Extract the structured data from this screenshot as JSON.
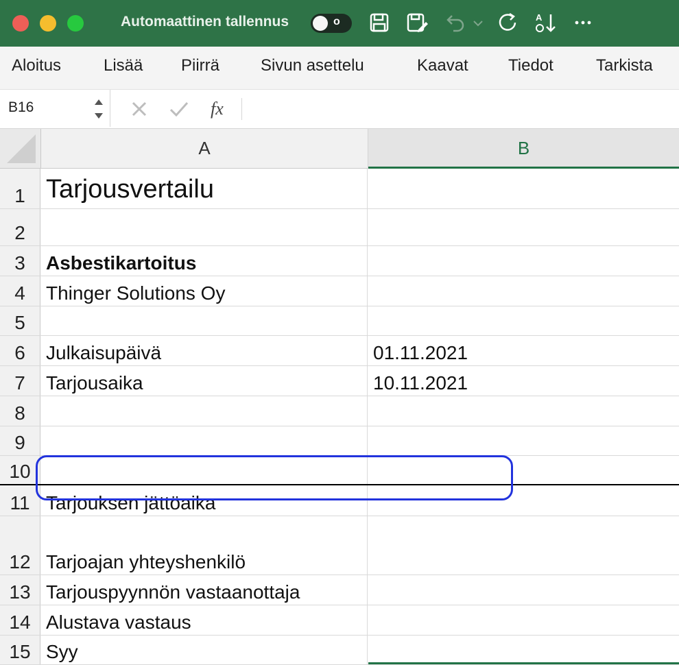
{
  "titlebar": {
    "autosave_label": "Automaattinen tallennus",
    "autosave_state": "o",
    "colors": {
      "background": "#2e7347"
    }
  },
  "toolbar_icons": [
    "save-icon",
    "save-as-icon",
    "undo-icon",
    "redo-icon",
    "sort-icon",
    "more-icon"
  ],
  "ribbon": {
    "tabs": [
      "Aloitus",
      "Lisää",
      "Piirrä",
      "Sivun asettelu",
      "Kaavat",
      "Tiedot",
      "Tarkista"
    ]
  },
  "formula_bar": {
    "name_box": "B16",
    "fx": "fx",
    "formula": ""
  },
  "grid": {
    "columns": [
      "A",
      "B"
    ],
    "selected_column": "B",
    "rows": [
      {
        "num": "1",
        "a": "Tarjousvertailu",
        "b": ""
      },
      {
        "num": "2",
        "a": "",
        "b": ""
      },
      {
        "num": "3",
        "a": "Asbestikartoitus",
        "b": ""
      },
      {
        "num": "4",
        "a": "Thinger Solutions Oy",
        "b": ""
      },
      {
        "num": "5",
        "a": "",
        "b": ""
      },
      {
        "num": "6",
        "a": "Julkaisupäivä",
        "b": "01.11.2021"
      },
      {
        "num": "7",
        "a": "Tarjousaika",
        "b": "10.11.2021"
      },
      {
        "num": "8",
        "a": "",
        "b": ""
      },
      {
        "num": "9",
        "a": "",
        "b": ""
      },
      {
        "num": "10",
        "a": "",
        "b": ""
      },
      {
        "num": "11",
        "a": "Tarjouksen jättöaika",
        "b": ""
      },
      {
        "num": "12",
        "a": "Tarjoajan yhteyshenkilö",
        "b": ""
      },
      {
        "num": "13",
        "a": "Tarjouspyynnön vastaanottaja",
        "b": ""
      },
      {
        "num": "14",
        "a": "Alustava vastaus",
        "b": ""
      },
      {
        "num": "15",
        "a": "Syy",
        "b": ""
      }
    ]
  },
  "colors": {
    "accent": "#217346",
    "highlight": "#2233dd"
  }
}
